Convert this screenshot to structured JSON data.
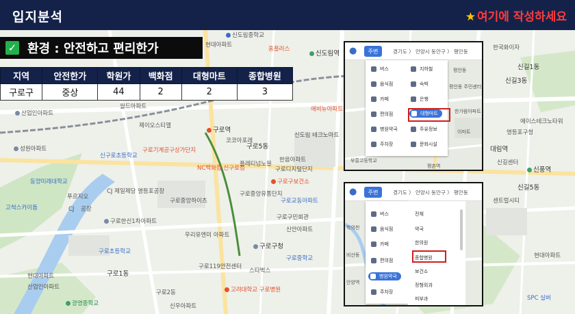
{
  "header": {
    "title": "입지분석",
    "note": "여기에 작성하세요"
  },
  "section": {
    "heading": "환경 : 안전하고 편리한가"
  },
  "table": {
    "columns": [
      "지역",
      "안전한가",
      "학원가",
      "백화점",
      "대형마트",
      "종합병원"
    ],
    "row": [
      "구로구",
      "중상",
      "44",
      "2",
      "2",
      "3"
    ]
  },
  "map_labels": {
    "l1": "신도림중학교",
    "l2": "신도림역",
    "l3": "현대아파트",
    "l4": "홈플러스",
    "l5": "산업인아파트",
    "l6": "월드아파트",
    "l7": "제이오스티엘",
    "l8": "구로역",
    "l9": "코코아포레",
    "l10": "구로기계공구상가단지",
    "l11": "NC백화점 신구로점",
    "l12": "성원아파트",
    "l13": "구로5동",
    "l14": "한음아파트",
    "l15": "플레티넘노블",
    "l16": "구로구보건소",
    "l17": "구로교동아파트",
    "l18": "구로구민회관",
    "l19": "구로중앙하이츠",
    "l20": "구로한신1차아파트",
    "l21": "신안아파트",
    "l22": "구로구청",
    "l23": "구로중학교",
    "l24": "구로119안전센터",
    "l25": "고려대학교 구로병원",
    "l26": "스타벅스",
    "l27": "구로초등학교",
    "l28": "고척스카이돔",
    "l29": "구로1동",
    "l30": "구로2동",
    "l31": "애비뉴아파트",
    "l32": "신구로초등학교",
    "l33": "신길3동",
    "l34": "한국화이자",
    "l35": "신풍역",
    "l36": "신길5동",
    "l37": "현대아파트",
    "l38": "신길1동",
    "l39": "SPC 실버",
    "l40": "영등포구청",
    "l41": "에이스테크노타워",
    "l42": "CJ 제일제당 영등포공장",
    "l43": "동양미래대학교",
    "l44": "현대아파트",
    "l45": "산업인아파트",
    "l46": "대림역",
    "l47": "센트럴시티",
    "l48": "신도림 테크노마트",
    "l49": "구로디지털단지",
    "l50": "푸르지오",
    "l51": "우리유엔미 아파트",
    "l52": "CJ",
    "l53": "공장",
    "l54": "광명중학교",
    "l55": "신우아파트",
    "l56": "구로중앙유통단지",
    "l57": "신길센터"
  },
  "panel_top": {
    "chip": "주변",
    "breadcrumb": "경기도  〉 안양시 동안구  〉 평안동",
    "menu": [
      "버스",
      "지하철",
      "음식점",
      "숙박",
      "카페",
      "은행",
      "편의점",
      "대형마트",
      "병원약국",
      "주유정보",
      "주차장",
      "문화시설"
    ],
    "selected": "대형마트",
    "map_labels": [
      "부흥고등학교",
      "평안동",
      "평촌역",
      "평안동 주민센터",
      "한가람아파트",
      "이마트"
    ]
  },
  "panel_bottom": {
    "chip": "주변",
    "breadcrumb": "경기도  〉 안양시 동안구  〉 평안동",
    "menu": [
      "버스",
      "음식점",
      "카페",
      "편의점",
      "병원약국",
      "주차장"
    ],
    "selected": "병원약국",
    "submenu": [
      "전체",
      "약국",
      "한의원",
      "종합병원",
      "보건소",
      "정형외과",
      "피부과",
      "안과"
    ],
    "highlight": "종합병원",
    "map_labels": [
      "학의천",
      "비산동",
      "안양역"
    ]
  },
  "colors": {
    "header_bg": "#14224a",
    "note": "#ff3b3b",
    "check": "#22b14c",
    "highlight": "#d01c1c",
    "chip": "#3a73d9"
  }
}
